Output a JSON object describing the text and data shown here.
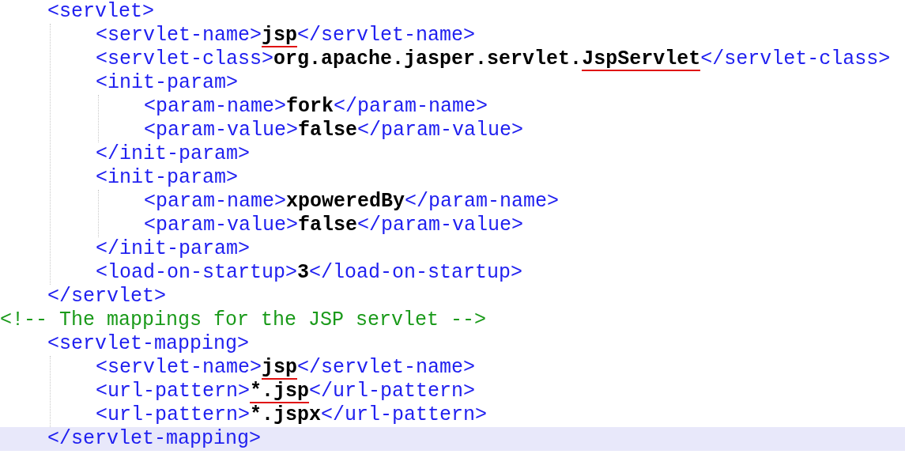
{
  "code": [
    {
      "kind": "group",
      "children": [
        {
          "kind": "line",
          "segments": [
            {
              "kind": "tag",
              "text": "<servlet>"
            }
          ],
          "children": [
            {
              "kind": "line",
              "segments": [
                {
                  "kind": "tag",
                  "text": "<servlet-name>"
                },
                {
                  "kind": "value",
                  "text": "jsp",
                  "underlined": true
                },
                {
                  "kind": "tag",
                  "text": "</servlet-name>"
                }
              ]
            },
            {
              "kind": "line",
              "segments": [
                {
                  "kind": "tag",
                  "text": "<servlet-class>"
                },
                {
                  "kind": "value",
                  "text": "org.apache.jasper.servlet.",
                  "underlined": false
                },
                {
                  "kind": "value",
                  "text": "JspServlet",
                  "underlined": true
                },
                {
                  "kind": "tag",
                  "text": "</servlet-class>"
                }
              ]
            },
            {
              "kind": "line",
              "segments": [
                {
                  "kind": "tag",
                  "text": "<init-param>"
                }
              ],
              "children": [
                {
                  "kind": "line",
                  "segments": [
                    {
                      "kind": "tag",
                      "text": "<param-name>"
                    },
                    {
                      "kind": "value",
                      "text": "fork",
                      "underlined": false
                    },
                    {
                      "kind": "tag",
                      "text": "</param-name>"
                    }
                  ]
                },
                {
                  "kind": "line",
                  "segments": [
                    {
                      "kind": "tag",
                      "text": "<param-value>"
                    },
                    {
                      "kind": "value",
                      "text": "false",
                      "underlined": false
                    },
                    {
                      "kind": "tag",
                      "text": "</param-value>"
                    }
                  ]
                }
              ]
            },
            {
              "kind": "line",
              "segments": [
                {
                  "kind": "tag",
                  "text": "</init-param>"
                }
              ]
            },
            {
              "kind": "line",
              "segments": [
                {
                  "kind": "tag",
                  "text": "<init-param>"
                }
              ],
              "children": [
                {
                  "kind": "line",
                  "segments": [
                    {
                      "kind": "tag",
                      "text": "<param-name>"
                    },
                    {
                      "kind": "value",
                      "text": "xpoweredBy",
                      "underlined": false
                    },
                    {
                      "kind": "tag",
                      "text": "</param-name>"
                    }
                  ]
                },
                {
                  "kind": "line",
                  "segments": [
                    {
                      "kind": "tag",
                      "text": "<param-value>"
                    },
                    {
                      "kind": "value",
                      "text": "false",
                      "underlined": false
                    },
                    {
                      "kind": "tag",
                      "text": "</param-value>"
                    }
                  ]
                }
              ]
            },
            {
              "kind": "line",
              "segments": [
                {
                  "kind": "tag",
                  "text": "</init-param>"
                }
              ]
            },
            {
              "kind": "line",
              "segments": [
                {
                  "kind": "tag",
                  "text": "<load-on-startup>"
                },
                {
                  "kind": "value",
                  "text": "3",
                  "underlined": false
                },
                {
                  "kind": "tag",
                  "text": "</load-on-startup>"
                }
              ]
            }
          ]
        },
        {
          "kind": "line",
          "segments": [
            {
              "kind": "tag",
              "text": "</servlet>"
            }
          ]
        }
      ]
    },
    {
      "kind": "line",
      "segments": [
        {
          "kind": "comment",
          "text": "<!-- The mappings for the JSP servlet -->"
        }
      ]
    },
    {
      "kind": "group",
      "children": [
        {
          "kind": "line",
          "segments": [
            {
              "kind": "tag",
              "text": "<servlet-mapping>"
            }
          ],
          "children": [
            {
              "kind": "line",
              "segments": [
                {
                  "kind": "tag",
                  "text": "<servlet-name>"
                },
                {
                  "kind": "value",
                  "text": "jsp",
                  "underlined": true
                },
                {
                  "kind": "tag",
                  "text": "</servlet-name>"
                }
              ]
            },
            {
              "kind": "line",
              "segments": [
                {
                  "kind": "tag",
                  "text": "<url-pattern>"
                },
                {
                  "kind": "value",
                  "text": "*.jsp",
                  "underlined": true
                },
                {
                  "kind": "tag",
                  "text": "</url-pattern>"
                }
              ]
            },
            {
              "kind": "line",
              "segments": [
                {
                  "kind": "tag",
                  "text": "<url-pattern>"
                },
                {
                  "kind": "value",
                  "text": "*.jspx",
                  "underlined": false
                },
                {
                  "kind": "tag",
                  "text": "</url-pattern>"
                }
              ]
            }
          ]
        },
        {
          "kind": "line",
          "highlighted": true,
          "segments": [
            {
              "kind": "tag",
              "text": "</servlet-mapping>"
            }
          ]
        }
      ]
    }
  ]
}
